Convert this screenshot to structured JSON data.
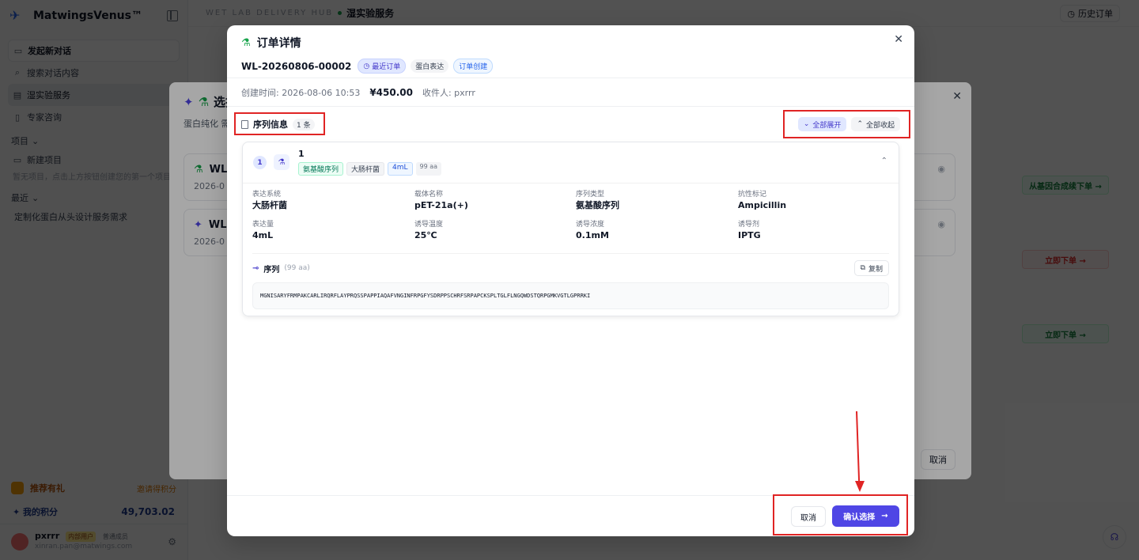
{
  "sidebar": {
    "brand": "MatwingsVenus™",
    "items": {
      "new_chat": "发起新对话",
      "search": "搜索对话内容",
      "wet_lab": "湿实验服务",
      "expert": "专家咨询"
    },
    "projects_label": "项目",
    "new_project": "新建项目",
    "empty_hint": "暂无项目，点击上方按钮创建您的第一个项目",
    "recent_label": "最近",
    "recent_item": "定制化蛋白从头设计服务需求",
    "promo": "推荐有礼",
    "promo_right": "邀请得积分",
    "points_label": "我的积分",
    "points_value": "49,703.02",
    "user_name": "pxrrr",
    "user_tag_inner": "内部用户",
    "user_tag_normal": "普通成员",
    "user_email": "xinran.pan@matwings.com"
  },
  "topbar": {
    "hub": "WET LAB DELIVERY HUB",
    "title": "湿实验服务",
    "history": "历史订单"
  },
  "right_actions": {
    "a1": "从基因合成续下单 →",
    "a2": "立即下单 →",
    "a3": "立即下单 →"
  },
  "modal2": {
    "title": "选择",
    "desc": "蛋白纯化 需",
    "card1_title": "WL",
    "card1_date": "2026-0",
    "card2_title": "WL",
    "card2_date": "2026-0",
    "cancel": "取消"
  },
  "modal": {
    "title": "订单详情",
    "order_no": "WL-20260806-00002",
    "chips": {
      "recent": "最近订单",
      "service": "蛋白表达",
      "status": "订单创建"
    },
    "created": "创建时间: 2026-08-06 10:53",
    "price": "¥450.00",
    "receiver": "收件人: pxrrr",
    "seq_label": "序列信息",
    "seq_count": "1 条",
    "expand_all": "全部展开",
    "collapse_all": "全部收起",
    "card": {
      "num": "1",
      "name": "1",
      "tags": [
        "氨基酸序列",
        "大肠杆菌",
        "4mL",
        "99 aa"
      ],
      "fields": [
        {
          "label": "表达系统",
          "value": "大肠杆菌"
        },
        {
          "label": "载体名称",
          "value": "pET-21a(+)"
        },
        {
          "label": "序列类型",
          "value": "氨基酸序列"
        },
        {
          "label": "抗性标记",
          "value": "Ampicillin"
        },
        {
          "label": "表达量",
          "value": "4mL"
        },
        {
          "label": "诱导温度",
          "value": "25℃"
        },
        {
          "label": "诱导浓度",
          "value": "0.1mM"
        },
        {
          "label": "诱导剂",
          "value": "IPTG"
        }
      ],
      "seq_title": "序列",
      "seq_len": "(99 aa)",
      "copy": "复制",
      "sequence": "MGNISARYFRMPAKCARLIRQRFLAYPRQSSPAPPIAQAFVNGINFRPGFYSDRPPSCHRFSRPAPCKSPLTGLFLNGQWDSTQRPGMKVGTLGPRRKI"
    },
    "cancel": "取消",
    "confirm": "确认选择"
  },
  "colors": {
    "accent": "#4f46e5",
    "annotation": "#e02424"
  }
}
